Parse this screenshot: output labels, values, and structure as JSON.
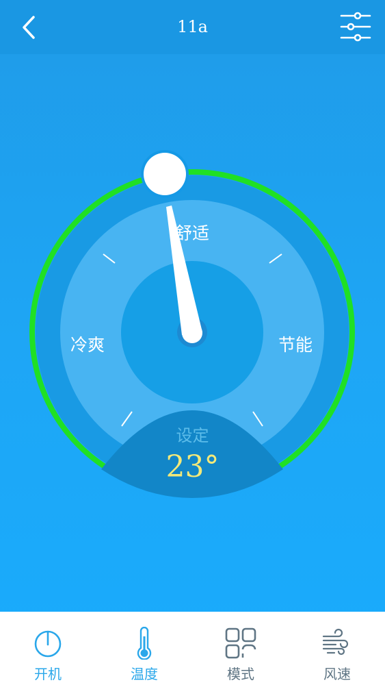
{
  "header": {
    "title": "11a",
    "back_icon": "chevron-left-icon",
    "settings_icon": "sliders-icon"
  },
  "gauge": {
    "mode_labels": {
      "top": "舒适",
      "left": "冷爽",
      "right": "节能"
    },
    "set_label": "设定",
    "set_value": "23°",
    "colors": {
      "arc_active": "#20e024",
      "set_value": "#f3e97a",
      "set_label": "#5bbcea"
    }
  },
  "bottom_nav": {
    "items": [
      {
        "label": "开机",
        "icon": "power-icon",
        "color": "#2aa7ea"
      },
      {
        "label": "温度",
        "icon": "thermometer-icon",
        "color": "#2aa7ea"
      },
      {
        "label": "模式",
        "icon": "mode-grid-icon",
        "color": "#5f7584"
      },
      {
        "label": "风速",
        "icon": "wind-icon",
        "color": "#5f7584"
      }
    ]
  }
}
